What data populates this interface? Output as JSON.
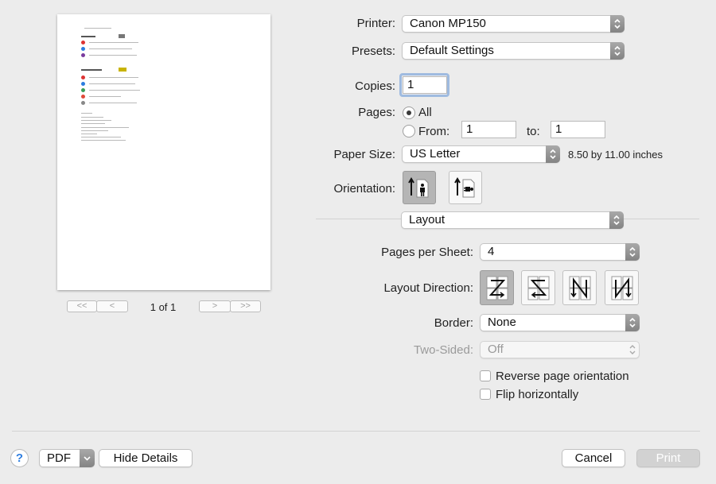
{
  "printer": {
    "label": "Printer:",
    "value": "Canon MP150"
  },
  "presets": {
    "label": "Presets:",
    "value": "Default Settings"
  },
  "copies": {
    "label": "Copies:",
    "value": "1"
  },
  "pages": {
    "label": "Pages:",
    "all_label": "All",
    "from_label": "From:",
    "from_value": "1",
    "to_label": "to:",
    "to_value": "1"
  },
  "paper_size": {
    "label": "Paper Size:",
    "value": "US Letter",
    "dimensions": "8.50 by 11.00 inches"
  },
  "orientation": {
    "label": "Orientation:"
  },
  "section_popup": {
    "value": "Layout"
  },
  "layout": {
    "pages_per_sheet_label": "Pages per Sheet:",
    "pages_per_sheet_value": "4",
    "direction_label": "Layout Direction:",
    "border_label": "Border:",
    "border_value": "None",
    "two_sided_label": "Two-Sided:",
    "two_sided_value": "Off",
    "reverse_label": "Reverse page orientation",
    "flip_label": "Flip horizontally"
  },
  "preview_nav": {
    "first": "<<",
    "prev": "<",
    "page_label": "1 of 1",
    "next": ">",
    "last": ">>"
  },
  "footer": {
    "help": "?",
    "pdf_label": "PDF",
    "hide_details_label": "Hide Details",
    "cancel_label": "Cancel",
    "print_label": "Print"
  }
}
